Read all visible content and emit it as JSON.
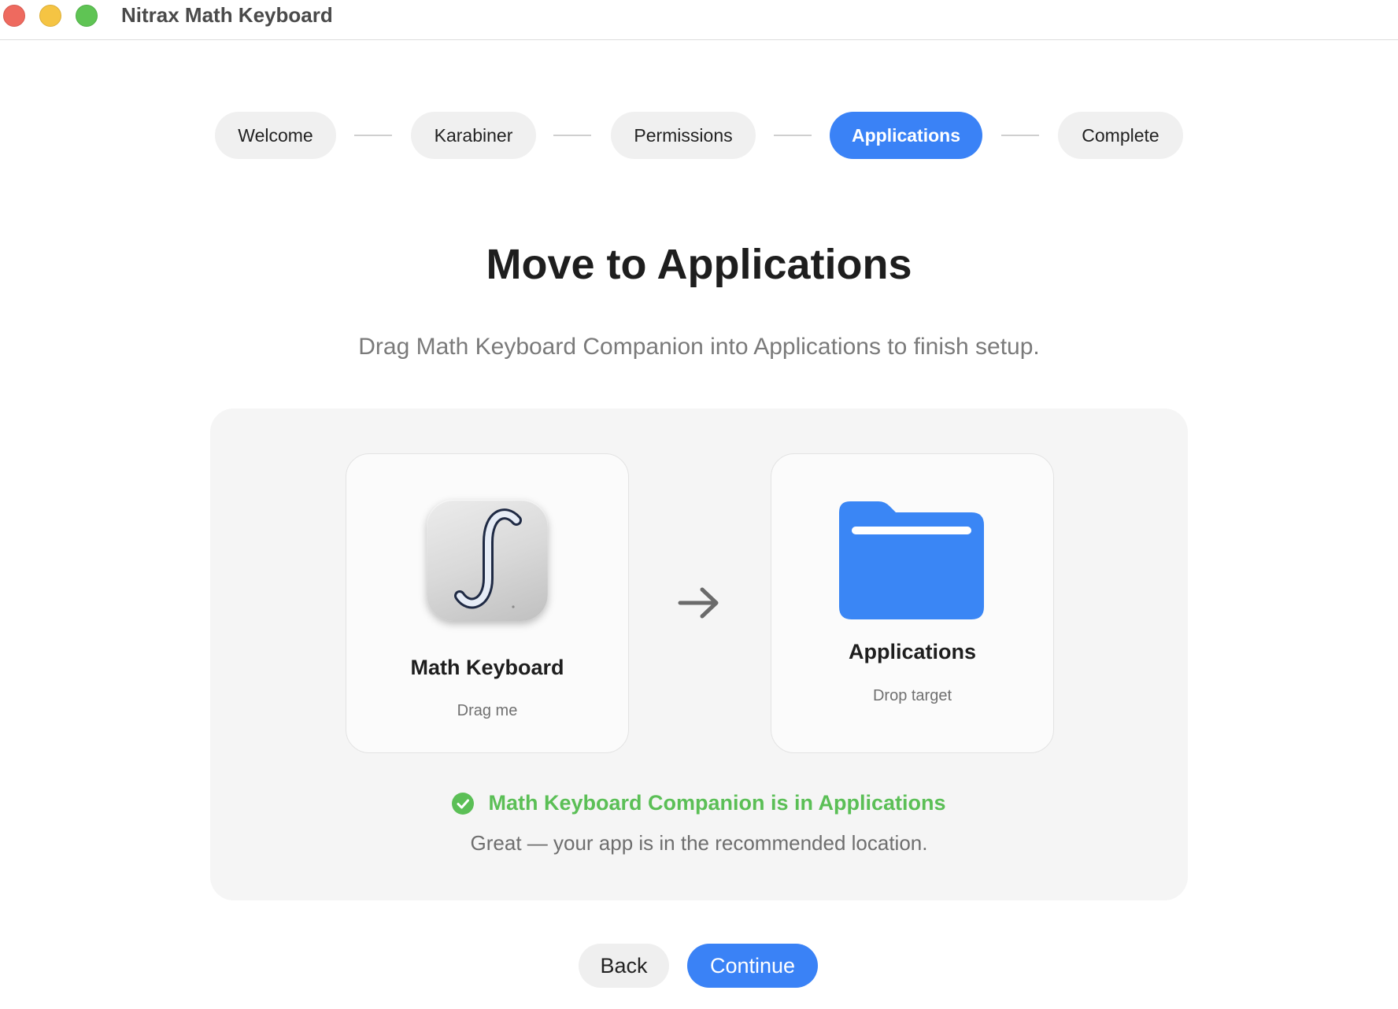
{
  "window": {
    "title": "Nitrax Math Keyboard",
    "traffic_lights": [
      "close",
      "minimize",
      "zoom"
    ]
  },
  "stepper": {
    "steps": [
      {
        "label": "Welcome",
        "active": false
      },
      {
        "label": "Karabiner",
        "active": false
      },
      {
        "label": "Permissions",
        "active": false
      },
      {
        "label": "Applications",
        "active": true
      },
      {
        "label": "Complete",
        "active": false
      }
    ]
  },
  "main": {
    "title": "Move to Applications",
    "subtitle": "Drag Math Keyboard Companion into Applications to finish setup."
  },
  "source_card": {
    "title": "Math Keyboard",
    "subtitle": "Drag me",
    "icon": "integral-app-icon"
  },
  "target_card": {
    "title": "Applications",
    "subtitle": "Drop target",
    "icon": "folder-icon"
  },
  "status": {
    "icon": "check-circle-icon",
    "text": "Math Keyboard Companion is in Applications",
    "note": "Great — your app is in the recommended location."
  },
  "buttons": {
    "back": "Back",
    "continue": "Continue"
  },
  "colors": {
    "accent": "#3a82f6",
    "success": "#5bbf56",
    "close": "#ee6a5f",
    "minimize": "#f5c443",
    "zoom": "#5fc454"
  }
}
